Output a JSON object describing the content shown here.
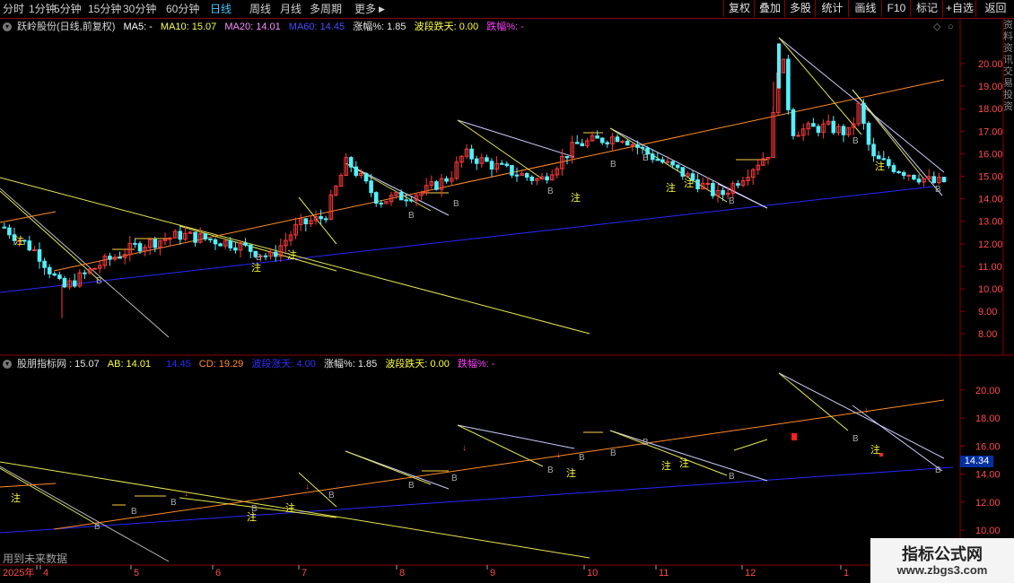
{
  "toolbar": {
    "periods": [
      {
        "label": "分时",
        "active": false
      },
      {
        "label": "1分钟",
        "active": false
      },
      {
        "label": "5分钟",
        "active": false
      },
      {
        "label": "15分钟",
        "active": false
      },
      {
        "label": "30分钟",
        "active": false
      },
      {
        "label": "60分钟",
        "active": false
      },
      {
        "label": "日线",
        "active": true
      },
      {
        "label": "周线",
        "active": false
      },
      {
        "label": "月线",
        "active": false
      },
      {
        "label": "多周期",
        "active": false
      },
      {
        "label": "更多",
        "active": false
      }
    ],
    "more_arrow": "▶",
    "right_buttons": [
      "复权",
      "叠加",
      "多股",
      "统计",
      "画线",
      "F10",
      "标记",
      "+自选",
      "返回"
    ]
  },
  "main_legend": {
    "stock": "跃岭股份(日线,前复权)",
    "ma5": "MA5: -",
    "ma10": "MA10: 15.07",
    "ma20": "MA20: 14.01",
    "ma60": "MA60: 14.45",
    "rise": "涨幅%: 1.85",
    "wave_drop": "波段跌天: 0.00",
    "drop": "跌幅%: -"
  },
  "sub_legend": {
    "name": "股朋指标网",
    "v1": ": 15.07",
    "ab": "AB: 14.01",
    "v3": "14.45",
    "cd": "CD: 19.29",
    "wave_rise": "波段涨天: 4.00",
    "rise": "涨幅%: 1.85",
    "wave_drop": "波段跌天: 0.00",
    "drop": "跌幅%: -"
  },
  "price_axis": [
    "20.00",
    "19.00",
    "18.00",
    "17.00",
    "16.00",
    "15.00",
    "14.00",
    "13.00",
    "12.00",
    "11.00",
    "10.00",
    "9.00",
    "8.00"
  ],
  "sub_axis": [
    "20.00",
    "18.00",
    "16.00",
    "14.00",
    "12.00",
    "10.00"
  ],
  "last_price": "14.34",
  "date_axis": [
    "2025年",
    "4",
    "5",
    "6",
    "7",
    "8",
    "9",
    "10",
    "11",
    "12",
    "1"
  ],
  "sidebar_text": "资料资讯交易投资",
  "future_note": "用到未来数据",
  "watermark": {
    "title": "指标公式网",
    "url": "www.zbgs3.com"
  },
  "marks": {
    "zhu": "注",
    "b": "B",
    "down": "↓"
  },
  "colors": {
    "up": "#ff3a3a",
    "down": "#54f0ff",
    "ma5": "#ffffff",
    "ma10": "#ffff40",
    "ma20": "#ff8cff",
    "ma60": "#4b4bff",
    "orange": "#ff8c28",
    "yellow": "#e6e650",
    "blueline": "#2828ff",
    "grid": "#8b0000"
  }
}
